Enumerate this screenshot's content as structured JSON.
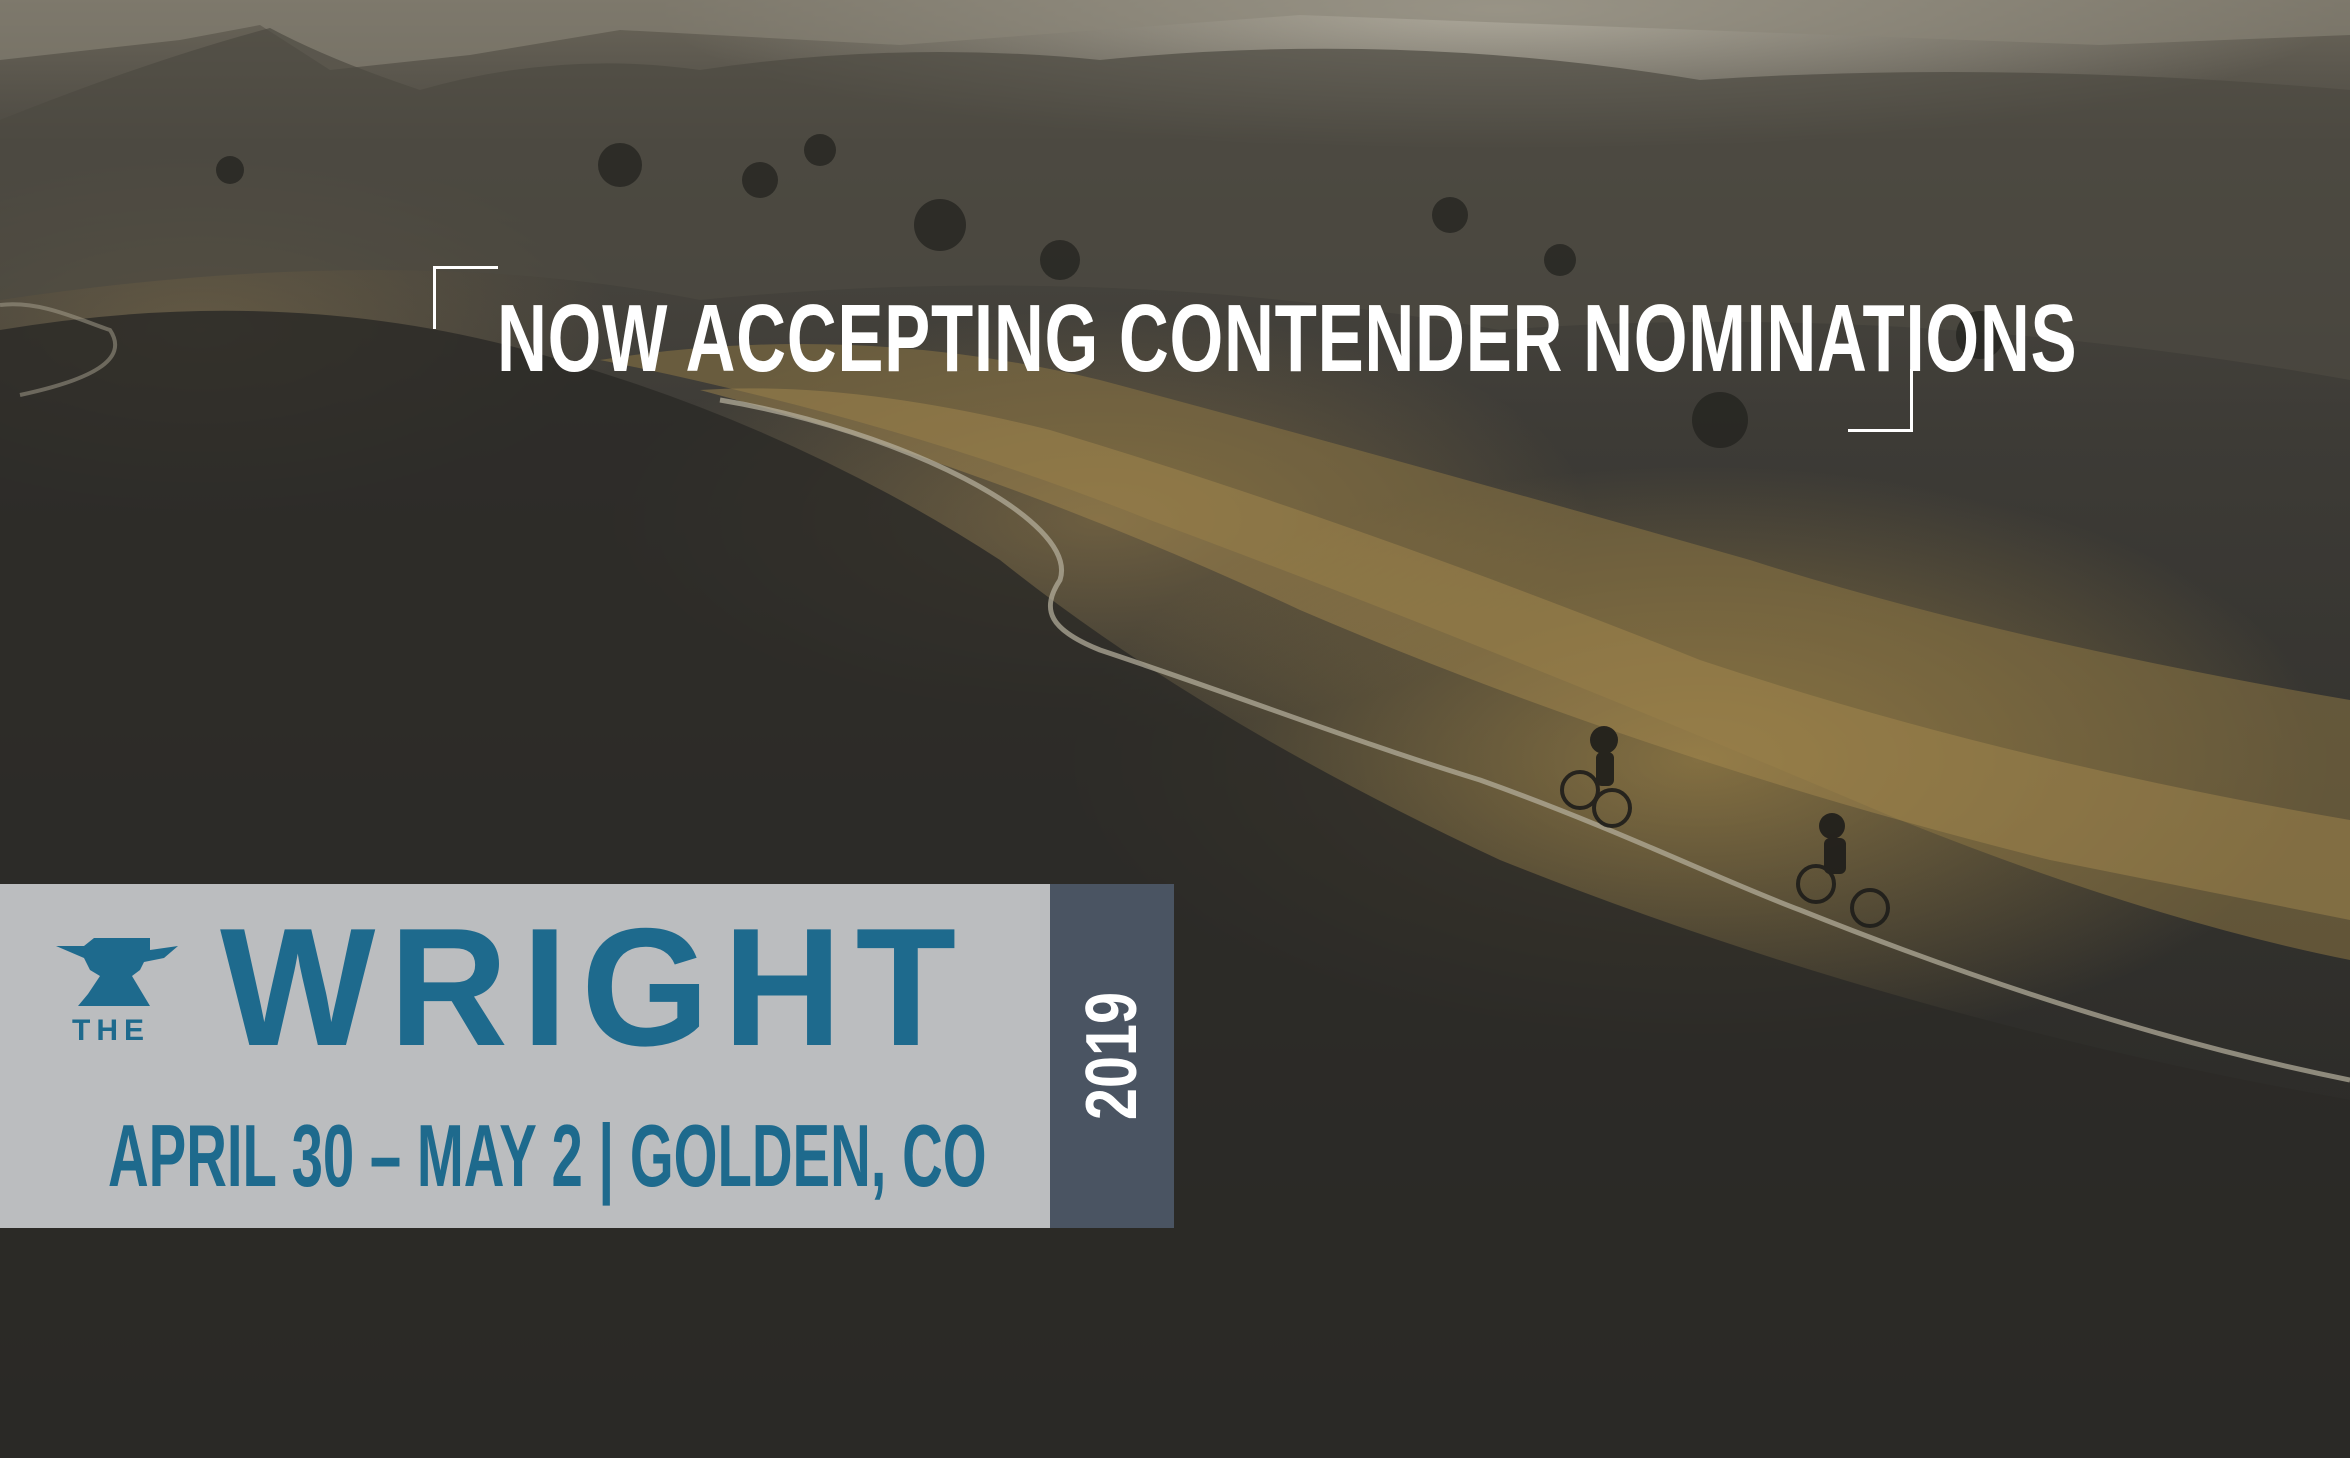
{
  "headline": {
    "text": "NOW ACCEPTING CONTENDER NOMINATIONS"
  },
  "event": {
    "prefix": "THE",
    "name": "WRIGHT",
    "dates_location": "APRIL 30 – MAY 2 | GOLDEN, CO",
    "year": "2019"
  },
  "colors": {
    "brand_blue": "#1e6a8d",
    "banner_gray": "#c8cacc",
    "year_box": "#4a5462",
    "headline": "#ffffff"
  },
  "icons": {
    "logo": "anvil-icon"
  }
}
